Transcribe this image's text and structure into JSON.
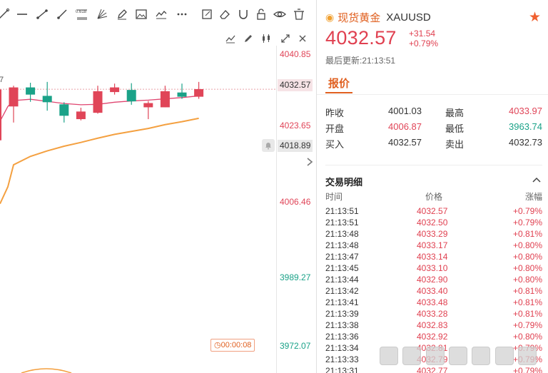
{
  "toolbar": {
    "icons": [
      "line-tool-icon",
      "horizontal-line-icon",
      "trend-line-icon",
      "ray-icon",
      "fibonacci-icon",
      "fan-icon",
      "pencil-icon",
      "image-icon",
      "indicator-icon",
      "more-icon",
      "note-icon",
      "eraser-icon",
      "magnet-icon",
      "lock-icon",
      "eye-icon",
      "trash-icon"
    ],
    "fib_label": "0.618"
  },
  "chart": {
    "price_ticks": [
      "4040.85",
      "4023.65",
      "4006.46",
      "3989.27",
      "3972.07"
    ],
    "current_price_label": "4032.57",
    "crosshair_price_label": "4018.89",
    "countdown": "00:00:08",
    "edge_label": "7",
    "colors": {
      "up": "#e04558",
      "down": "#1aa288",
      "ma_short": "#e04570",
      "ma_long": "#f4a040"
    }
  },
  "symbol": {
    "name": "现货黄金",
    "code": "XAUUSD",
    "price": "4032.57",
    "change": "+31.54",
    "change_pct": "+0.79%",
    "last_update": "最后更新:21:13:51"
  },
  "tabs": {
    "quote": "报价"
  },
  "quote": {
    "prev_close_label": "昨收",
    "prev_close": "4001.03",
    "high_label": "最高",
    "high": "4033.97",
    "open_label": "开盘",
    "open": "4006.87",
    "low_label": "最低",
    "low": "3963.74",
    "bid_label": "买入",
    "bid": "4032.57",
    "ask_label": "卖出",
    "ask": "4032.73"
  },
  "trades": {
    "title": "交易明细",
    "col_time": "时间",
    "col_price": "价格",
    "col_change": "涨幅",
    "rows": [
      {
        "time": "21:13:51",
        "price": "4032.57",
        "pct": "+0.79%"
      },
      {
        "time": "21:13:51",
        "price": "4032.50",
        "pct": "+0.79%"
      },
      {
        "time": "21:13:48",
        "price": "4033.29",
        "pct": "+0.81%"
      },
      {
        "time": "21:13:48",
        "price": "4033.17",
        "pct": "+0.80%"
      },
      {
        "time": "21:13:47",
        "price": "4033.14",
        "pct": "+0.80%"
      },
      {
        "time": "21:13:45",
        "price": "4033.10",
        "pct": "+0.80%"
      },
      {
        "time": "21:13:44",
        "price": "4032.90",
        "pct": "+0.80%"
      },
      {
        "time": "21:13:42",
        "price": "4033.40",
        "pct": "+0.81%"
      },
      {
        "time": "21:13:41",
        "price": "4033.48",
        "pct": "+0.81%"
      },
      {
        "time": "21:13:39",
        "price": "4033.28",
        "pct": "+0.81%"
      },
      {
        "time": "21:13:38",
        "price": "4032.83",
        "pct": "+0.79%"
      },
      {
        "time": "21:13:36",
        "price": "4032.92",
        "pct": "+0.80%"
      },
      {
        "time": "21:13:34",
        "price": "4032.81",
        "pct": "+0.79%"
      },
      {
        "time": "21:13:33",
        "price": "4032.79",
        "pct": "+0.79%"
      },
      {
        "time": "21:13:31",
        "price": "4032.77",
        "pct": "+0.79%"
      }
    ]
  },
  "candles": [
    {
      "o": 4028.5,
      "h": 4033.4,
      "l": 4024.7,
      "c": 4033.0
    },
    {
      "o": 4033.0,
      "h": 4034.1,
      "l": 4029.6,
      "c": 4031.3
    },
    {
      "o": 4031.0,
      "h": 4034.3,
      "l": 4027.5,
      "c": 4029.5
    },
    {
      "o": 4029.0,
      "h": 4029.5,
      "l": 4024.7,
      "c": 4026.3
    },
    {
      "o": 4025.5,
      "h": 4028.2,
      "l": 4025.2,
      "c": 4027.3
    },
    {
      "o": 4027.0,
      "h": 4033.4,
      "l": 4026.8,
      "c": 4032.1
    },
    {
      "o": 4031.9,
      "h": 4033.9,
      "l": 4031.3,
      "c": 4033.0
    },
    {
      "o": 4032.4,
      "h": 4034.0,
      "l": 4028.9,
      "c": 4029.7
    },
    {
      "o": 4028.3,
      "h": 4029.8,
      "l": 4025.5,
      "c": 4029.3
    },
    {
      "o": 4028.3,
      "h": 4033.4,
      "l": 4028.3,
      "c": 4032.1
    },
    {
      "o": 4031.8,
      "h": 4033.9,
      "l": 4030.3,
      "c": 4030.8
    },
    {
      "o": 4030.8,
      "h": 4034.3,
      "l": 4030.3,
      "c": 4032.6
    }
  ],
  "ma_short": [
    4029.9,
    4030.2,
    4029.7,
    4029.2,
    4028.9,
    4029.0,
    4029.5,
    4029.8,
    4030.0,
    4030.3,
    4030.6,
    4031.0
  ],
  "ma_long": [
    4014.7,
    4016.7,
    4018.0,
    4019.1,
    4020.0,
    4021.0,
    4021.9,
    4022.6,
    4023.3,
    4024.2,
    4024.9,
    4025.7
  ]
}
